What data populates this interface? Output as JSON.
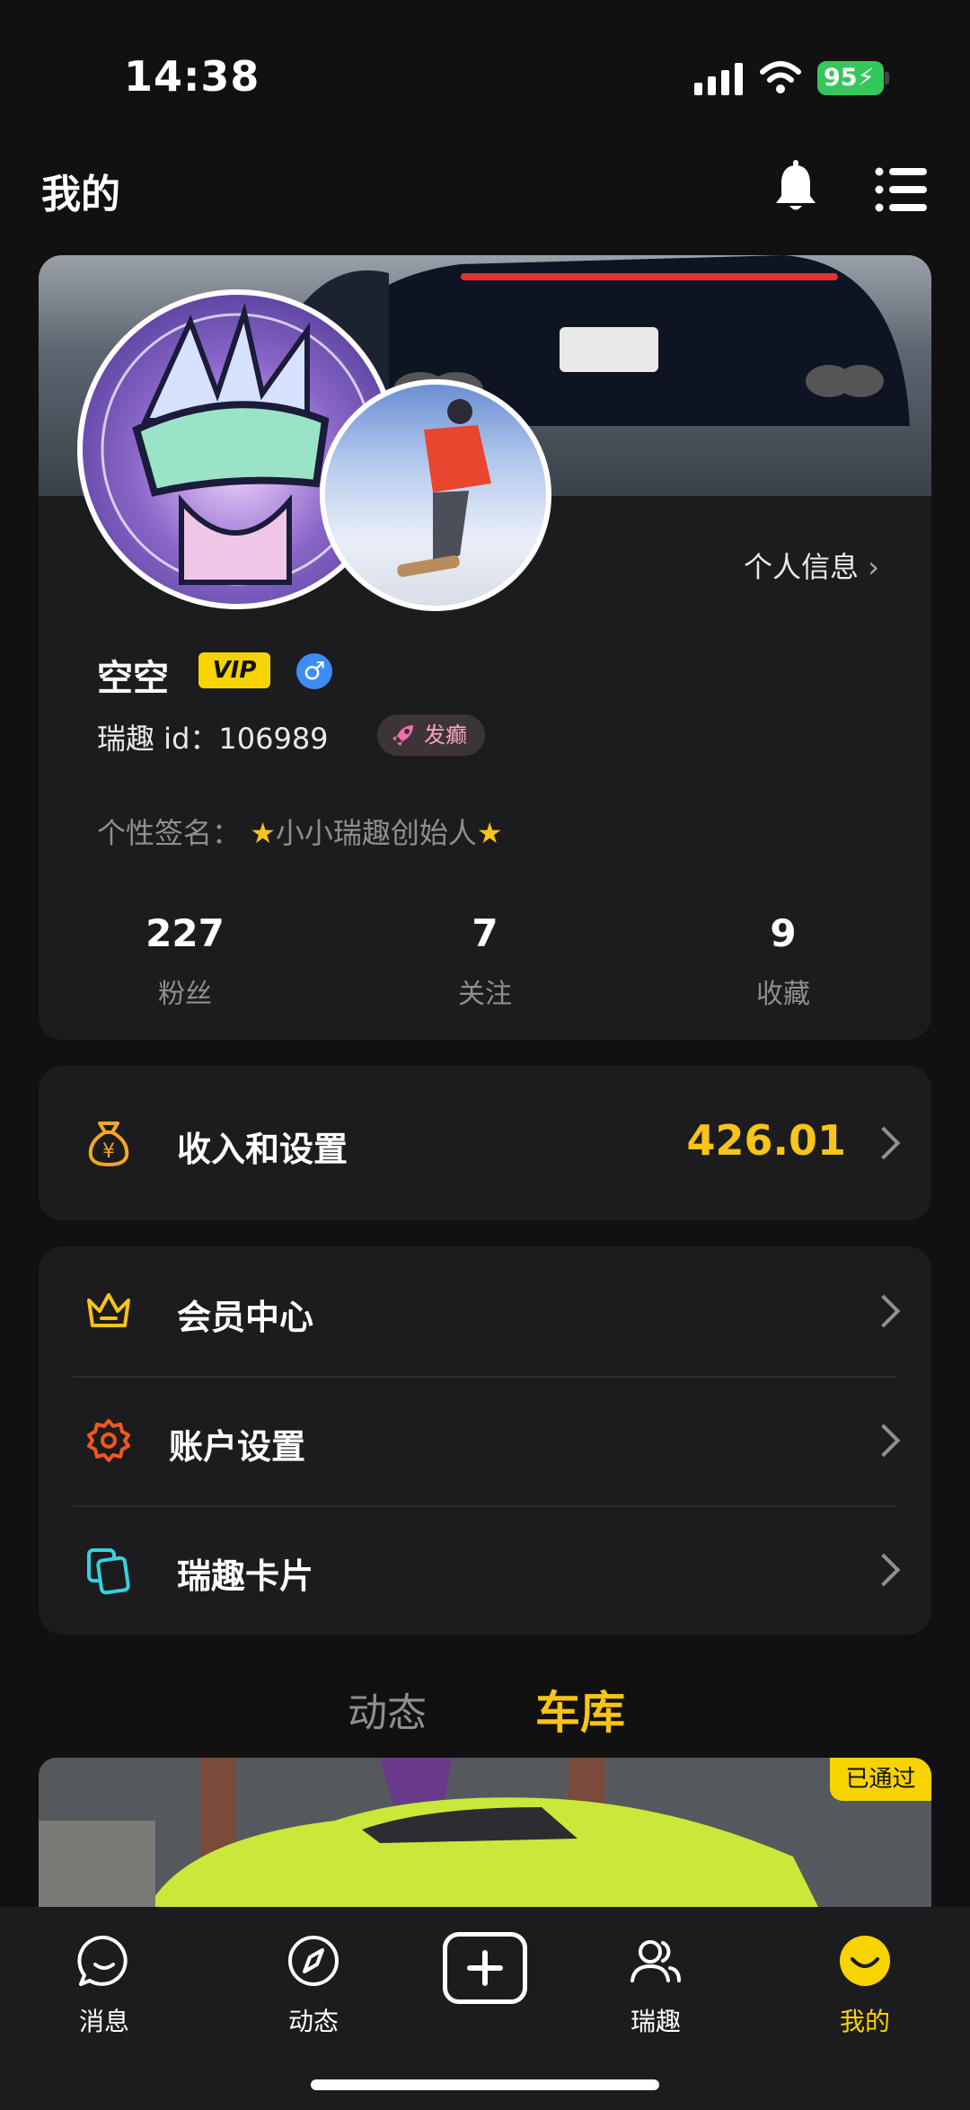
{
  "status_bar": {
    "time": "14:38",
    "battery": "95"
  },
  "header": {
    "title": "我的"
  },
  "profile": {
    "info_link": "个人信息",
    "name": "空空",
    "vip_badge": "VIP",
    "gender_symbol": "♂",
    "uid": "瑞趣 id：106989",
    "tag": "发癫",
    "signature_label": "个性签名：",
    "signature_text": "小小瑞趣创始人",
    "stats": [
      {
        "value": "227",
        "label": "粉丝"
      },
      {
        "value": "7",
        "label": "关注"
      },
      {
        "value": "9",
        "label": "收藏"
      }
    ]
  },
  "income": {
    "label": "收入和设置",
    "value": "426.01"
  },
  "settings": [
    {
      "label": "会员中心",
      "icon": "crown-icon"
    },
    {
      "label": "账户设置",
      "icon": "gear-icon"
    },
    {
      "label": "瑞趣卡片",
      "icon": "cards-icon"
    }
  ],
  "feed_tabs": [
    {
      "label": "动态",
      "active": false
    },
    {
      "label": "车库",
      "active": true
    }
  ],
  "feed": {
    "badge": "已通过"
  },
  "bottom_nav": [
    {
      "label": "消息",
      "icon": "message-icon"
    },
    {
      "label": "动态",
      "icon": "compass-icon"
    },
    {
      "label": "瑞趣",
      "icon": "people-icon"
    },
    {
      "label": "我的",
      "icon": "smile-icon",
      "active": true
    }
  ],
  "colors": {
    "accent": "#f7c417",
    "background": "#111111",
    "card": "#1c1c1e"
  }
}
